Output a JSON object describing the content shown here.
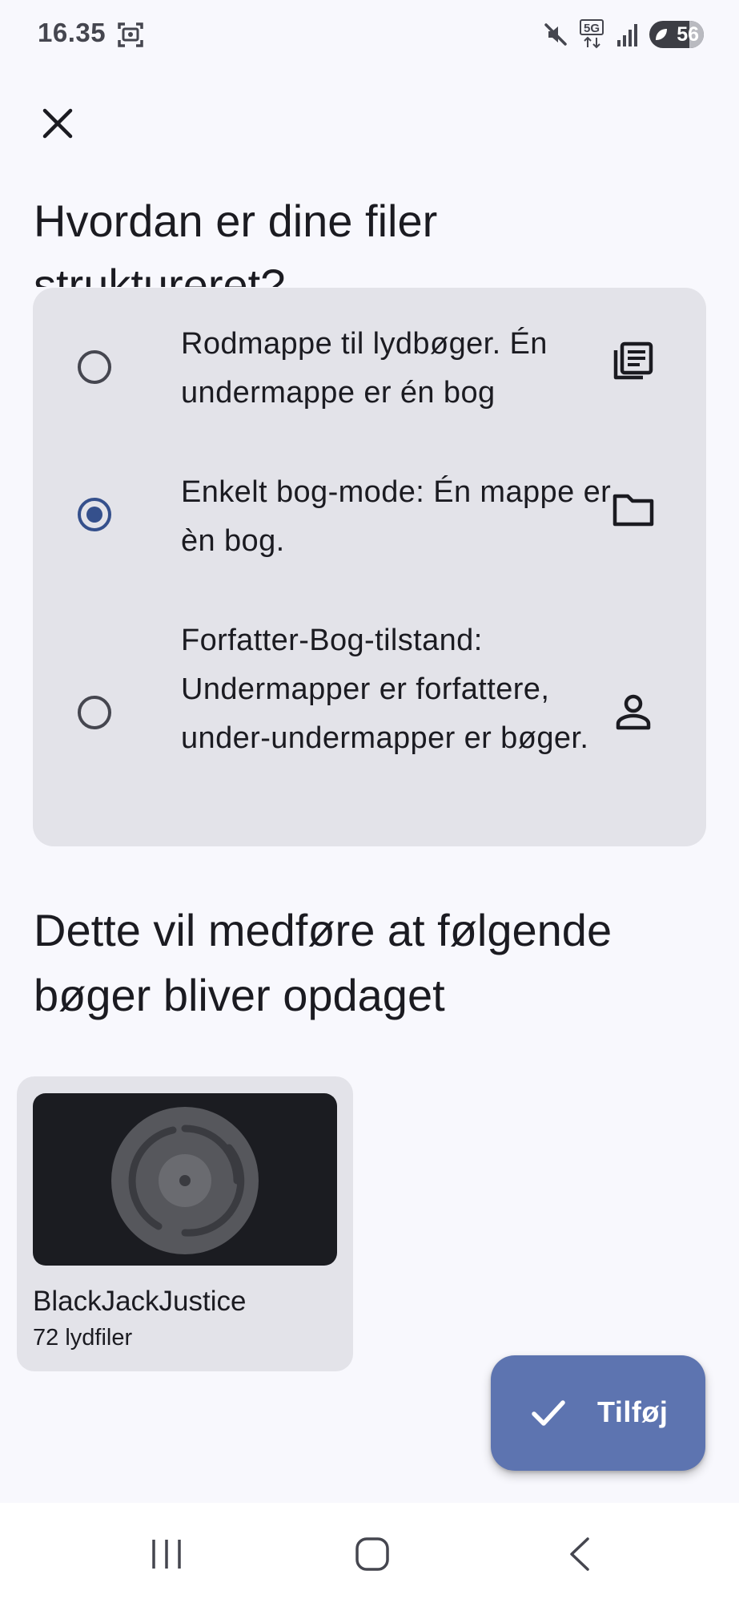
{
  "status_bar": {
    "time": "16.35",
    "network": "5G",
    "battery": "56",
    "icons": [
      "screenshot-icon",
      "mute-icon",
      "network-5g-icon",
      "signal-icon",
      "battery-icon"
    ]
  },
  "header": {
    "close_icon": "close-icon",
    "title": "Hvordan er dine filer struktureret?"
  },
  "options": [
    {
      "label": "Rodmappe til lydbøger. Én undermappe er én bog",
      "icon": "library-books-icon",
      "selected": false
    },
    {
      "label": "Enkelt bog-mode: Én mappe er èn bog.",
      "icon": "folder-icon",
      "selected": true
    },
    {
      "label": "Forfatter-Bog-tilstand: Undermapper er forfattere, under-undermapper er bøger.",
      "icon": "person-icon",
      "selected": false
    }
  ],
  "discovery": {
    "heading": "Dette vil medføre at følgende bøger bliver opdaget",
    "books": [
      {
        "title": "BlackJackJustice",
        "meta": "72 lydfiler",
        "cover_icon": "audiobook-placeholder-icon"
      }
    ]
  },
  "fab": {
    "label": "Tilføj",
    "icon": "check-icon"
  },
  "nav_bar": {
    "icons": [
      "recent-apps-icon",
      "home-icon",
      "back-icon"
    ]
  },
  "colors": {
    "background": "#f8f8fd",
    "card": "#e3e3e9",
    "accent": "#35508c",
    "fab": "#5d74b0",
    "cover": "#1b1c21"
  }
}
